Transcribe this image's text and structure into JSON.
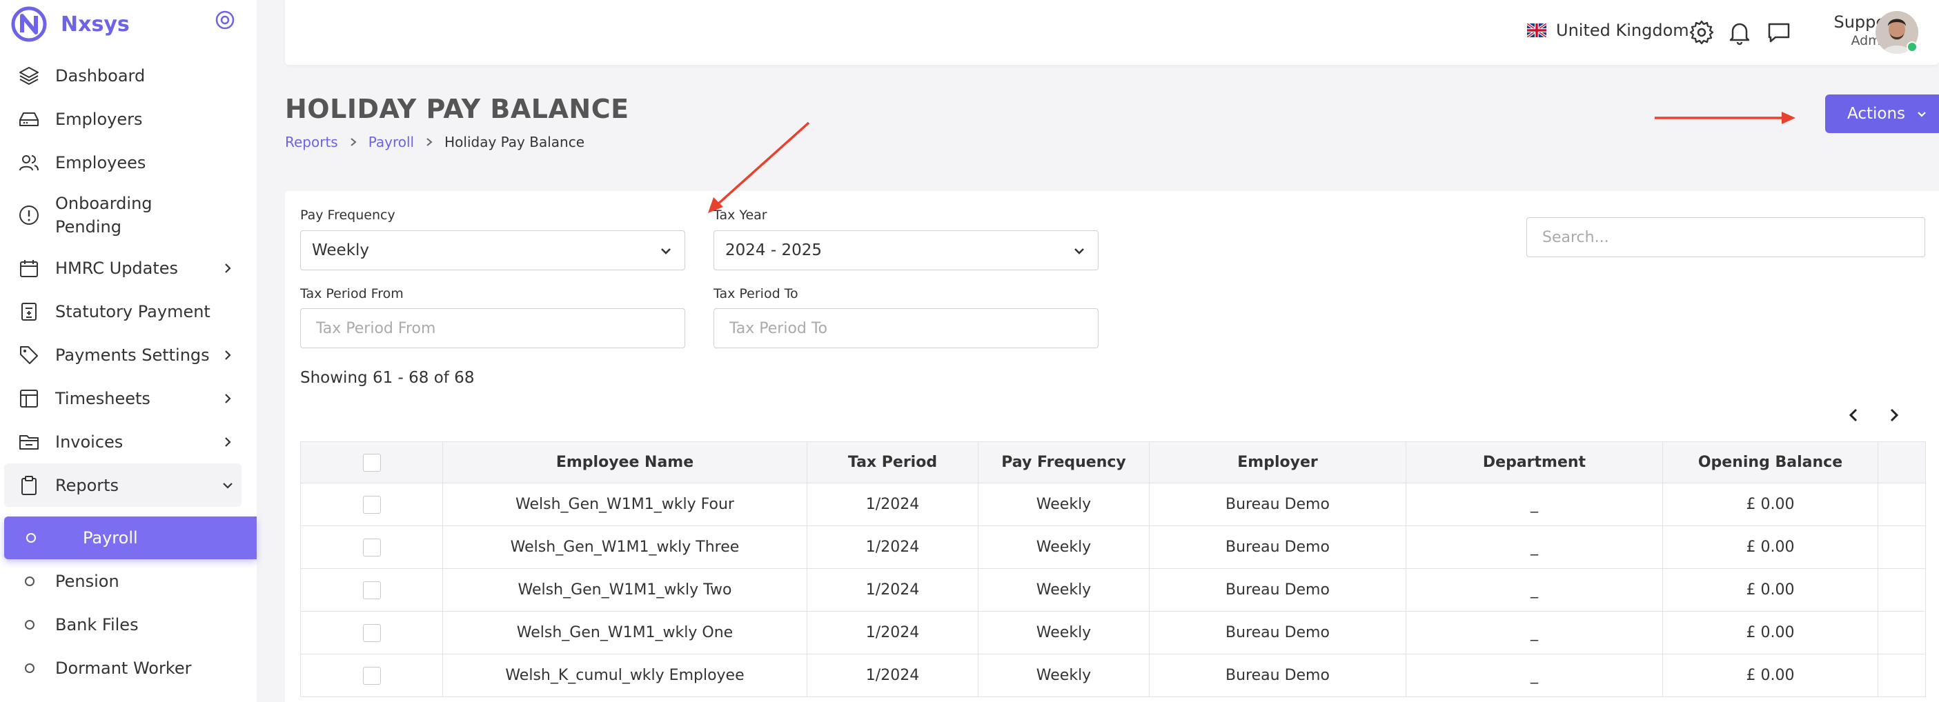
{
  "brand": {
    "name": "Nxsys"
  },
  "sidebar": {
    "items": [
      {
        "label": "Dashboard",
        "icon": "layers-icon",
        "has_children": false
      },
      {
        "label": "Employers",
        "icon": "drive-icon",
        "has_children": false
      },
      {
        "label": "Employees",
        "icon": "users-icon",
        "has_children": false
      },
      {
        "label": "Onboarding Pending",
        "icon": "alert-circle-icon",
        "has_children": false
      },
      {
        "label": "HMRC Updates",
        "icon": "calendar-icon",
        "has_children": true
      },
      {
        "label": "Statutory Payment",
        "icon": "calculator-icon",
        "has_children": false
      },
      {
        "label": "Payments Settings",
        "icon": "tag-icon",
        "has_children": true
      },
      {
        "label": "Timesheets",
        "icon": "table-icon",
        "has_children": true
      },
      {
        "label": "Invoices",
        "icon": "folder-icon",
        "has_children": true
      },
      {
        "label": "Reports",
        "icon": "clipboard-icon",
        "has_children": true,
        "expanded": true
      }
    ],
    "report_sub_items": [
      {
        "label": "Payroll",
        "active": true
      },
      {
        "label": "Pension",
        "active": false
      },
      {
        "label": "Bank Files",
        "active": false
      },
      {
        "label": "Dormant Worker",
        "active": false
      }
    ]
  },
  "topbar": {
    "country": "United Kingdom",
    "user_name": "Supper",
    "user_role": "Admin"
  },
  "header": {
    "title": "HOLIDAY PAY BALANCE",
    "breadcrumb": [
      "Reports",
      "Payroll",
      "Holiday Pay Balance"
    ],
    "actions_label": "Actions"
  },
  "filters": {
    "pay_frequency_label": "Pay Frequency",
    "pay_frequency_value": "Weekly",
    "tax_year_label": "Tax Year",
    "tax_year_value": "2024 - 2025",
    "tax_period_from_label": "Tax Period From",
    "tax_period_from_placeholder": "Tax Period From",
    "tax_period_to_label": "Tax Period To",
    "tax_period_to_placeholder": "Tax Period To",
    "search_placeholder": "Search..."
  },
  "showing": "Showing 61 - 68 of 68",
  "table": {
    "columns": [
      "Employee Name",
      "Tax Period",
      "Pay Frequency",
      "Employer",
      "Department",
      "Opening Balance"
    ],
    "rows": [
      [
        "Welsh_Gen_W1M1_wkly Four",
        "1/2024",
        "Weekly",
        "Bureau Demo",
        "_",
        "£ 0.00"
      ],
      [
        "Welsh_Gen_W1M1_wkly Three",
        "1/2024",
        "Weekly",
        "Bureau Demo",
        "_",
        "£ 0.00"
      ],
      [
        "Welsh_Gen_W1M1_wkly Two",
        "1/2024",
        "Weekly",
        "Bureau Demo",
        "_",
        "£ 0.00"
      ],
      [
        "Welsh_Gen_W1M1_wkly One",
        "1/2024",
        "Weekly",
        "Bureau Demo",
        "_",
        "£ 0.00"
      ],
      [
        "Welsh_K_cumul_wkly Employee",
        "1/2024",
        "Weekly",
        "Bureau Demo",
        "_",
        "£ 0.00"
      ]
    ]
  },
  "colors": {
    "accent": "#6c63e8",
    "active_nav": "#7b6ef0",
    "annotation_arrow": "#e8412c"
  }
}
